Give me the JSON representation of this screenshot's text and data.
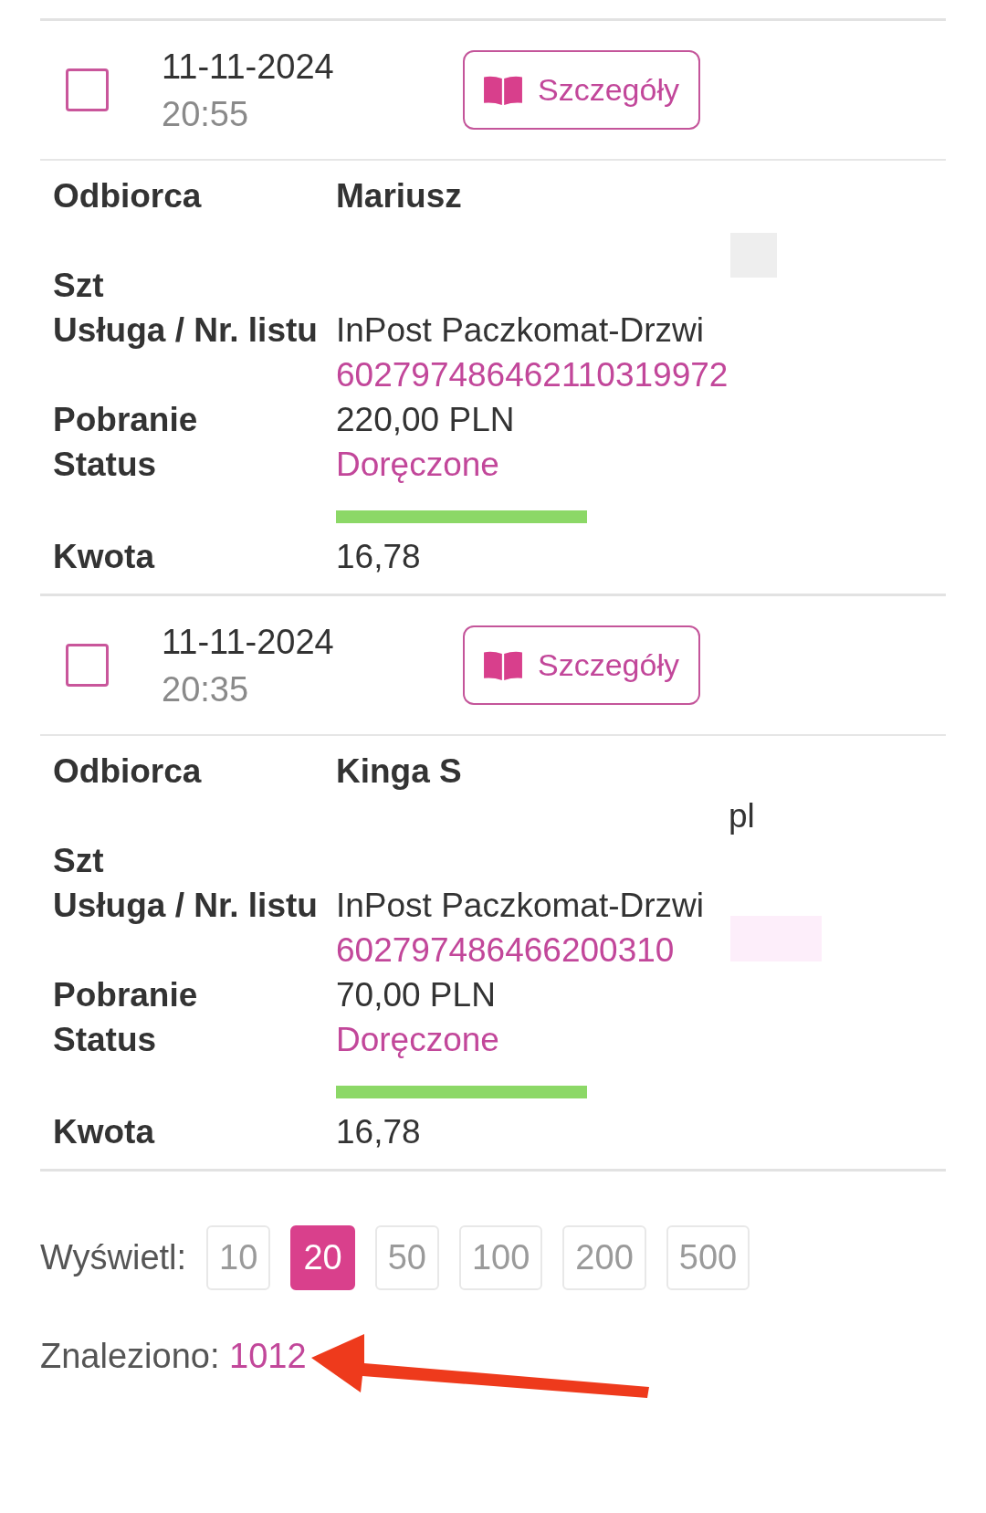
{
  "shipments": [
    {
      "checked": false,
      "date": "11-11-2024",
      "time": "20:55",
      "details_button": "Szczegóły",
      "recipient_label": "Odbiorca",
      "recipient": "Mariusz",
      "pieces_label": "Szt",
      "service_label": "Usługa / Nr. listu",
      "service": "InPost Paczkomat-Drzwi",
      "tracking_number": "602797486462110319972",
      "cod_label": "Pobranie",
      "cod": "220,00 PLN",
      "status_label": "Status",
      "status": {
        "text": "Doręczone",
        "color": "#8cd867"
      },
      "amount_label": "Kwota",
      "amount": "16,78"
    },
    {
      "checked": false,
      "date": "11-11-2024",
      "time": "20:35",
      "details_button": "Szczegóły",
      "recipient_label": "Odbiorca",
      "recipient": "Kinga S",
      "email_fragment": "pl",
      "pieces_label": "Szt",
      "service_label": "Usługa / Nr. listu",
      "service": "InPost Paczkomat-Drzwi",
      "tracking_number": "602797486466200310",
      "cod_label": "Pobranie",
      "cod": "70,00 PLN",
      "status_label": "Status",
      "status": {
        "text": "Doręczone",
        "color": "#8cd867"
      },
      "amount_label": "Kwota",
      "amount": "16,78"
    }
  ],
  "pagination": {
    "label": "Wyświetl:",
    "options": [
      {
        "label": "10",
        "selected": false
      },
      {
        "label": "20",
        "selected": true
      },
      {
        "label": "50",
        "selected": false
      },
      {
        "label": "100",
        "selected": false
      },
      {
        "label": "200",
        "selected": false
      },
      {
        "label": "500",
        "selected": false
      }
    ]
  },
  "found": {
    "label": "Znaleziono:",
    "count": "1012"
  }
}
